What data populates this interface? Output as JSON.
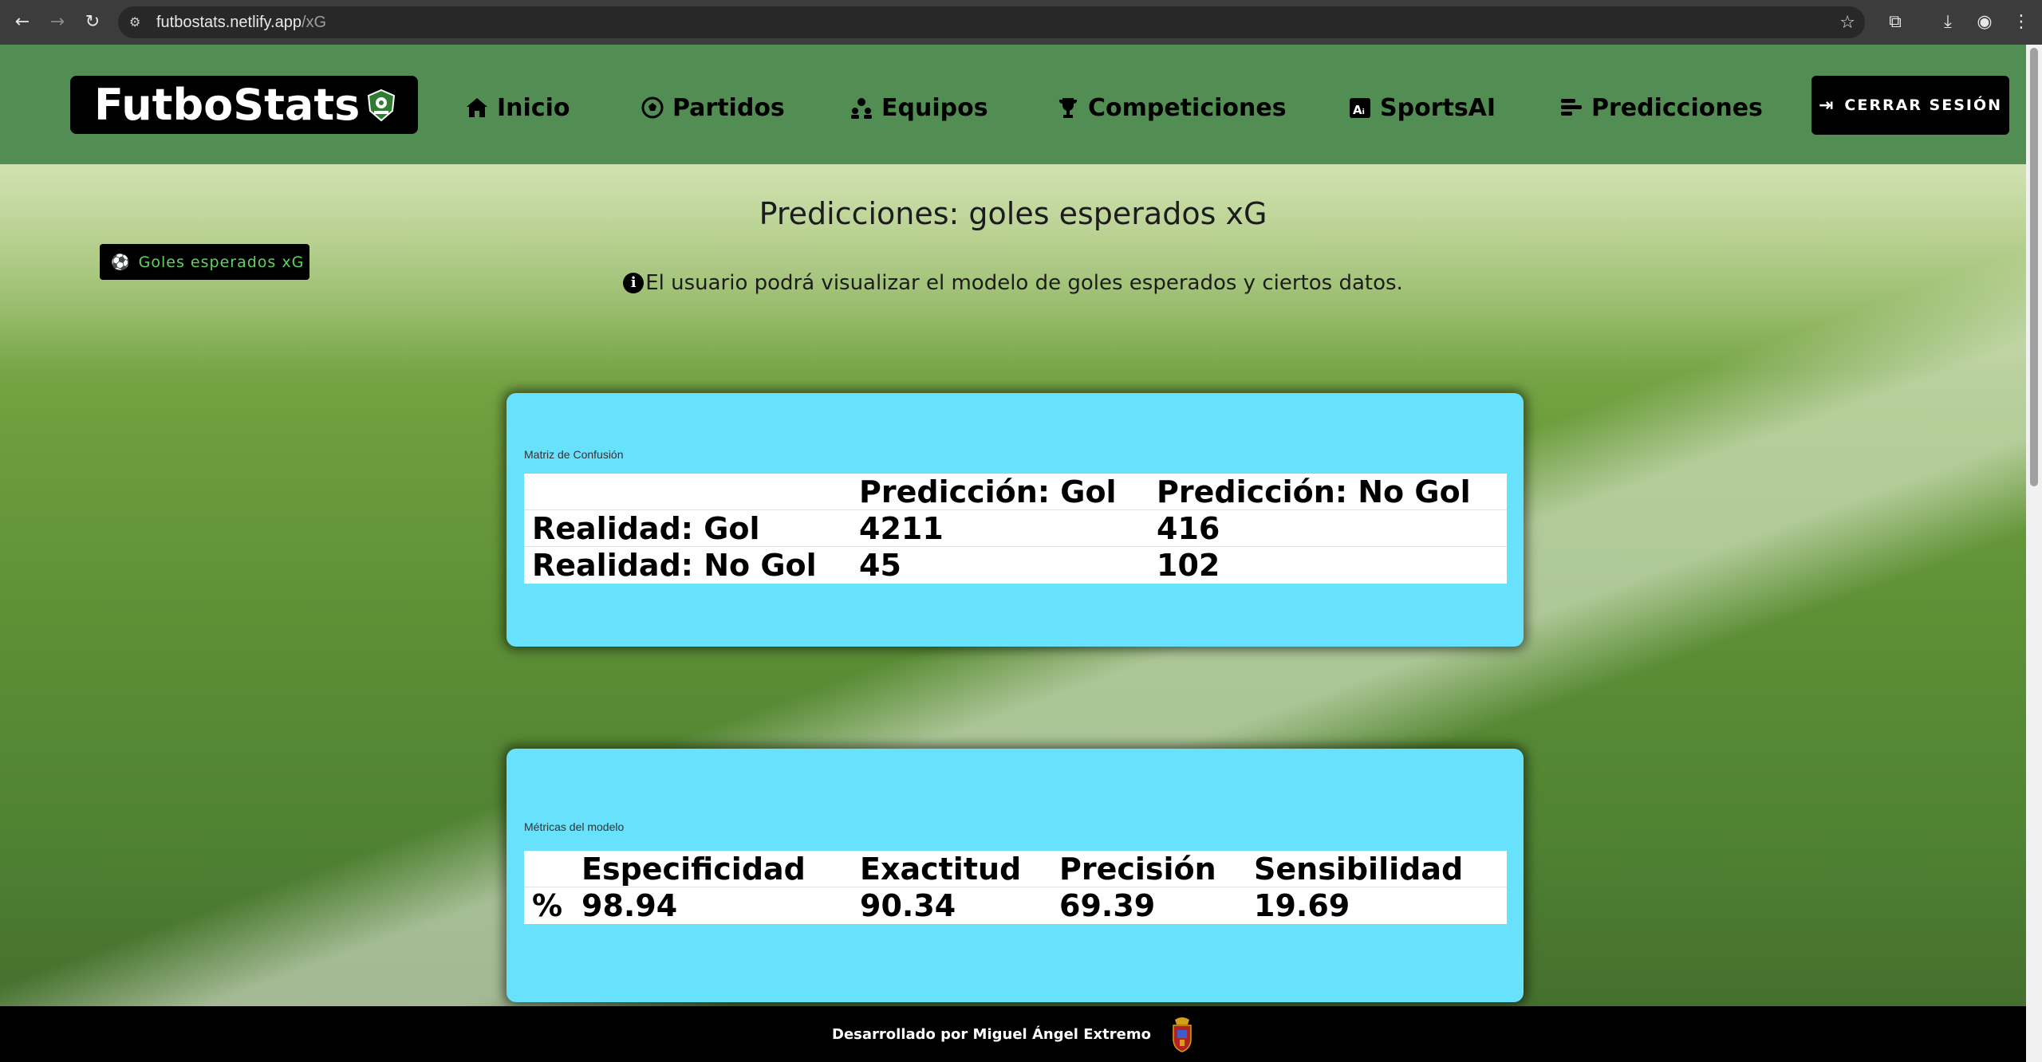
{
  "browser": {
    "url_host": "futbostats.netlify.app",
    "url_path": "/xG"
  },
  "header": {
    "brand": "FutboStats",
    "nav": [
      {
        "label": "Inicio",
        "icon": "home-icon"
      },
      {
        "label": "Partidos",
        "icon": "soccer-ball-icon"
      },
      {
        "label": "Equipos",
        "icon": "team-icon"
      },
      {
        "label": "Competiciones",
        "icon": "trophy-icon"
      },
      {
        "label": "SportsAI",
        "icon": "ai-icon"
      },
      {
        "label": "Predicciones",
        "icon": "bars-icon"
      }
    ],
    "logout_label": "CERRAR SESIÓN"
  },
  "page": {
    "title": "Predicciones: goles esperados xG",
    "subtitle": "El usuario podrá visualizar el modelo de goles esperados y ciertos datos.",
    "side_tab": "Goles esperados xG"
  },
  "confusion": {
    "caption": "Matriz de Confusión",
    "header": [
      "",
      "Predicción: Gol",
      "Predicción: No Gol"
    ],
    "rows": [
      [
        "Realidad: Gol",
        "4211",
        "416"
      ],
      [
        "Realidad: No Gol",
        "45",
        "102"
      ]
    ]
  },
  "metrics": {
    "caption": "Métricas del modelo",
    "header": [
      "",
      "Especificidad",
      "Exactitud",
      "Precisión",
      "Sensibilidad"
    ],
    "row": [
      "%",
      "98.94",
      "90.34",
      "69.39",
      "19.69"
    ]
  },
  "footer": {
    "text": "Desarrollado por Miguel Ángel Extremo"
  },
  "colors": {
    "header_bg": "#528d53",
    "card_bg": "#68e1fd",
    "tab_text": "#5fd35f"
  }
}
